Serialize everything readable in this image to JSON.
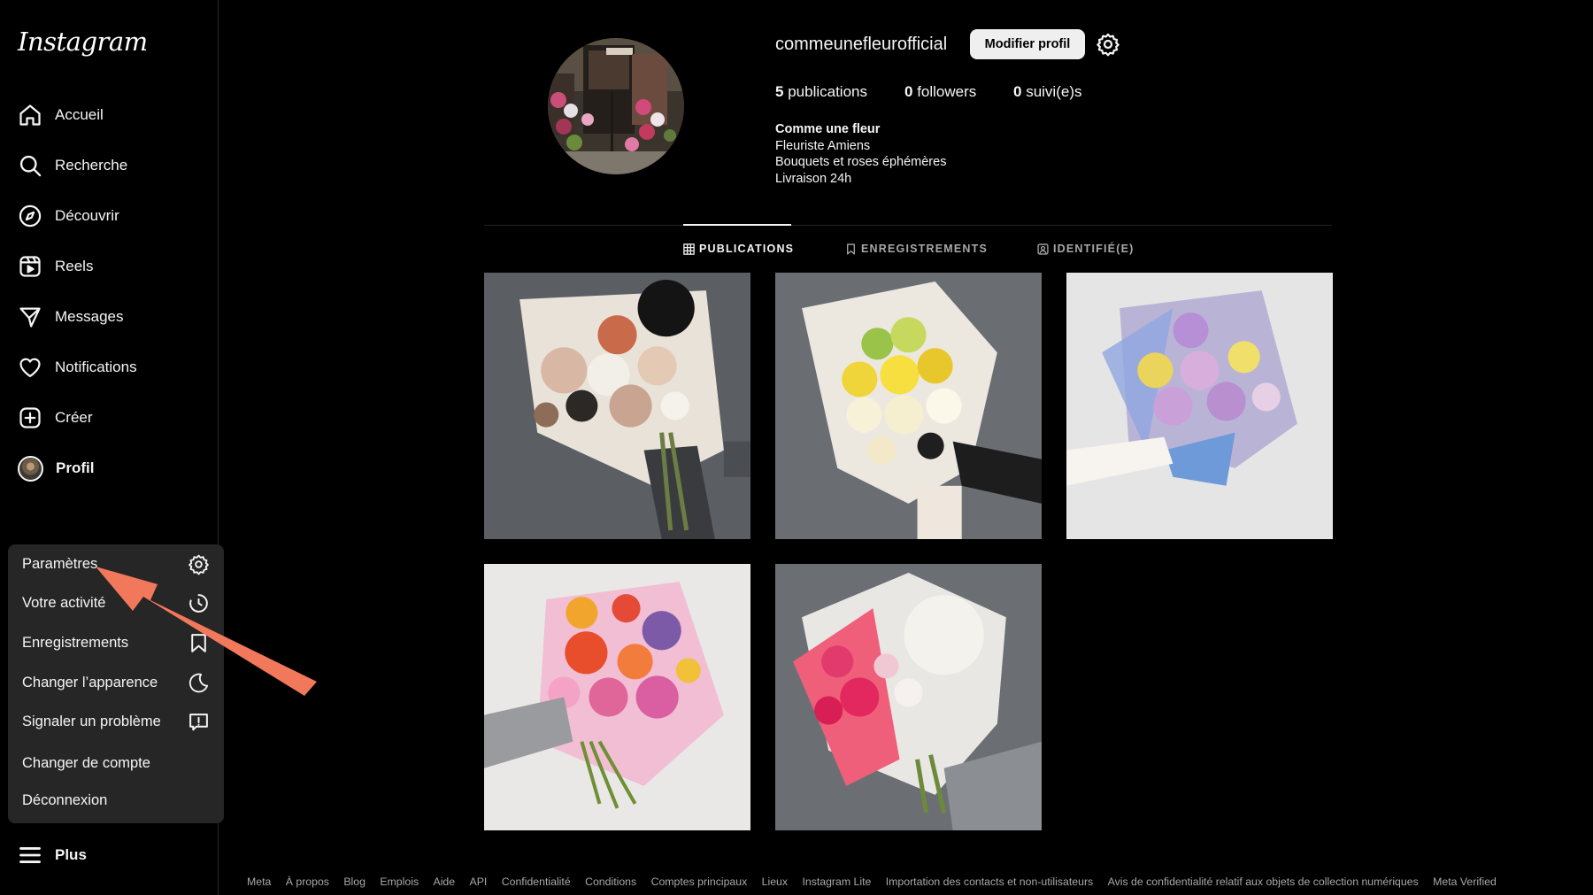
{
  "app": {
    "logo_text": "Instagram"
  },
  "sidebar": {
    "items": [
      {
        "label": "Accueil",
        "icon": "home-icon"
      },
      {
        "label": "Recherche",
        "icon": "search-icon"
      },
      {
        "label": "Découvrir",
        "icon": "compass-icon"
      },
      {
        "label": "Reels",
        "icon": "reels-icon"
      },
      {
        "label": "Messages",
        "icon": "paper-plane-icon"
      },
      {
        "label": "Notifications",
        "icon": "heart-icon"
      },
      {
        "label": "Créer",
        "icon": "plus-square-icon"
      },
      {
        "label": "Profil",
        "icon": "avatar"
      }
    ],
    "more_label": "Plus"
  },
  "more_menu": {
    "items": [
      {
        "label": "Paramètres",
        "icon": "gear-icon"
      },
      {
        "label": "Votre activité",
        "icon": "activity-icon"
      },
      {
        "label": "Enregistrements",
        "icon": "bookmark-icon"
      },
      {
        "label": "Changer l’apparence",
        "icon": "moon-icon"
      },
      {
        "label": "Signaler un problème",
        "icon": "report-icon"
      },
      {
        "label": "Changer de compte",
        "icon": ""
      },
      {
        "label": "Déconnexion",
        "icon": ""
      }
    ]
  },
  "profile": {
    "username": "commeunefleurofficial",
    "edit_button": "Modifier profil",
    "stats": [
      {
        "count": "5",
        "label": "publications"
      },
      {
        "count": "0",
        "label": "followers"
      },
      {
        "count": "0",
        "label": "suivi(e)s"
      }
    ],
    "bio": {
      "name": "Comme une fleur",
      "lines": [
        "Fleuriste Amiens",
        "Bouquets et roses éphémères",
        "Livraison 24h"
      ]
    }
  },
  "tabs": [
    {
      "label": "PUBLICATIONS",
      "icon": "grid-icon",
      "active": true
    },
    {
      "label": "ENREGISTREMENTS",
      "icon": "bookmark-icon",
      "active": false
    },
    {
      "label": "IDENTIFIÉ(E)",
      "icon": "tagged-icon",
      "active": false
    }
  ],
  "posts": [
    {
      "subject": "bouquet-cream-white-roses"
    },
    {
      "subject": "bouquet-yellow-white"
    },
    {
      "subject": "bouquet-pastel-lavender"
    },
    {
      "subject": "bouquet-colorful-tropical"
    },
    {
      "subject": "bouquet-pink-white-hydrangea"
    }
  ],
  "footer": {
    "links": [
      "Meta",
      "À propos",
      "Blog",
      "Emplois",
      "Aide",
      "API",
      "Confidentialité",
      "Conditions",
      "Comptes principaux",
      "Lieux",
      "Instagram Lite",
      "Importation des contacts et non-utilisateurs",
      "Avis de confidentialité relatif aux objets de collection numériques",
      "Meta Verified"
    ]
  },
  "colors": {
    "background": "#000000",
    "text": "#f5f5f5",
    "muted": "#a8a8a8",
    "menu_bg": "#262626",
    "annotation_arrow": "#f2785c"
  }
}
